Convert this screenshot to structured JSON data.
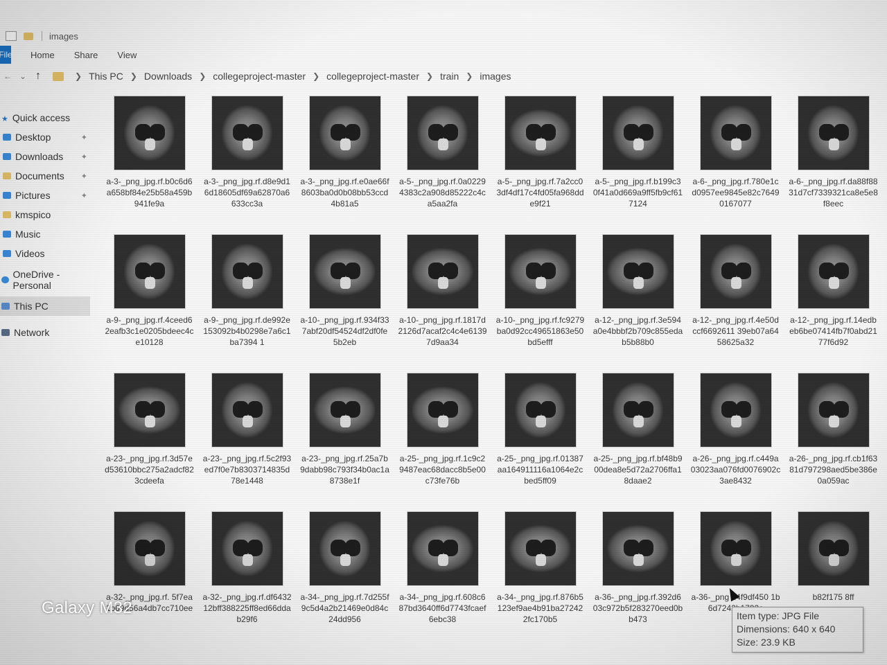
{
  "window": {
    "title": "images"
  },
  "ribbon": {
    "tabs": [
      "File",
      "Home",
      "Share",
      "View"
    ]
  },
  "breadcrumb": [
    "This PC",
    "Downloads",
    "collegeproject-master",
    "collegeproject-master",
    "train",
    "images"
  ],
  "sidebar": {
    "quick_access": "Quick access",
    "items": [
      "Desktop",
      "Downloads",
      "Documents",
      "Pictures",
      "kmspico",
      "Music",
      "Videos"
    ],
    "onedrive": "OneDrive - Personal",
    "this_pc": "This PC",
    "network": "Network"
  },
  "files": [
    "a-3-_png_jpg.rf.b0c6d6a658bf84e25b58a459b941fe9a",
    "a-3-_png_jpg.rf.d8e9d16d18605df69a62870a6633cc3a",
    "a-3-_png_jpg.rf.e0ae66f8603ba0d0b08bb53ccd4b81a5",
    "a-5-_png_jpg.rf.0a02294383c2a908d85222c4ca5aa2fa",
    "a-5-_png_jpg.rf.7a2cc03df4df17c4fd05fa968dde9f21",
    "a-5-_png_jpg.rf.b199c30f41a0d669a9ff5fb9cf617124",
    "a-6-_png_jpg.rf.780e1cd0957ee9845e82c76490167077",
    "a-6-_png_jpg.rf.da88f8831d7cf7339321ca8e5e8f8eec",
    "a-9-_png_jpg.rf.4ceed62eafb3c1e0205bdeec4ce10128",
    "a-9-_png_jpg.rf.de992e153092b4b0298e7a6c1ba7394 1",
    "a-10-_png_jpg.rf.934f337abf20df54524df2df0fe5b2eb",
    "a-10-_png_jpg.rf.1817d2126d7acaf2c4c4e61397d9aa34",
    "a-10-_png_jpg.rf.fc9279ba0d92cc49651863e50bd5efff",
    "a-12-_png_jpg.rf.3e594a0e4bbbf2b709c855edab5b88b0",
    "a-12-_png_jpg.rf.4e50dccf6692611 39eb07a6458625a32",
    "a-12-_png_jpg.rf.14edbeb6be07414fb7f0abd2177f6d92",
    "a-23-_png_jpg.rf.3d57ed53610bbc275a2adcf823cdeefa",
    "a-23-_png_jpg.rf.5c2f93ed7f0e7b8303714835d78e1448",
    "a-23-_png_jpg.rf.25a7b9dabb98c793f34b0ac1a8738e1f",
    "a-25-_png_jpg.rf.1c9c29487eac68dacc8b5e00c73fe76b",
    "a-25-_png_jpg.rf.01387aa164911116a1064e2cbed5ff09",
    "a-25-_png_jpg.rf.bf48b900dea8e5d72a2706ffa18daae2",
    "a-26-_png_jpg.rf.c449a03023aa076fd0076902c3ae8432",
    "a-26-_png_jpg.rf.cb1f6381d797298aed5be386e0a059ac",
    "a-32-_png_jpg.rf. 5f7ea1b69d56a4db7cc710ee",
    "a-32-_png_jpg.rf.df643212bff388225ff8ed66ddab29f6",
    "a-34-_png_jpg.rf.7d255f9c5d4a2b21469e0d84c24dd956",
    "a-34-_png_jpg.rf.608c687bd3640ff6d7743fcaef6ebc38",
    "a-34-_png_jpg.rf.876b5123ef9ae4b91ba272422fc170b5",
    "a-36-_png_jpg.rf.392d603c972b5f283270eed0bb473",
    "a-36-_png d4f9df450 1b6d7242b1792c",
    "b82f175 8ff"
  ],
  "tooltip": {
    "type": "Item type: JPG File",
    "dimensions": "Dimensions: 640 x 640",
    "size": "Size: 23.9 KB"
  },
  "watermark": "Galaxy M32"
}
